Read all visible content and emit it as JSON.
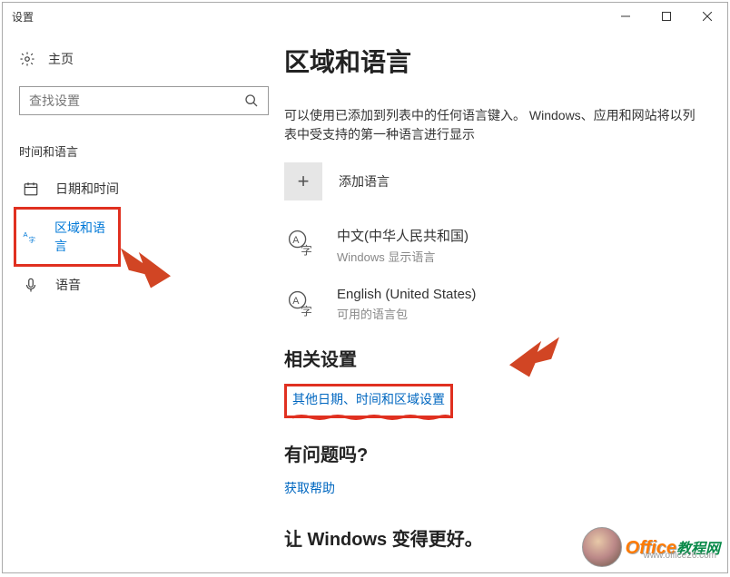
{
  "titlebar": {
    "title": "设置"
  },
  "sidebar": {
    "home": "主页",
    "search_placeholder": "查找设置",
    "section": "时间和语言",
    "items": [
      {
        "label": "日期和时间"
      },
      {
        "label": "区域和语言"
      },
      {
        "label": "语音"
      }
    ]
  },
  "main": {
    "heading": "区域和语言",
    "description": "可以使用已添加到列表中的任何语言键入。 Windows、应用和网站将以列表中受支持的第一种语言进行显示",
    "add_language": "添加语言",
    "languages": [
      {
        "name": "中文(中华人民共和国)",
        "sub": "Windows 显示语言"
      },
      {
        "name": "English (United States)",
        "sub": "可用的语言包"
      }
    ],
    "related_heading": "相关设置",
    "related_link": "其他日期、时间和区域设置",
    "question_heading": "有问题吗?",
    "help_link": "获取帮助",
    "better_heading": "让 Windows 变得更好。"
  },
  "watermark": {
    "text1": "Office",
    "text2": "教程网",
    "url": "www.office26.com"
  }
}
